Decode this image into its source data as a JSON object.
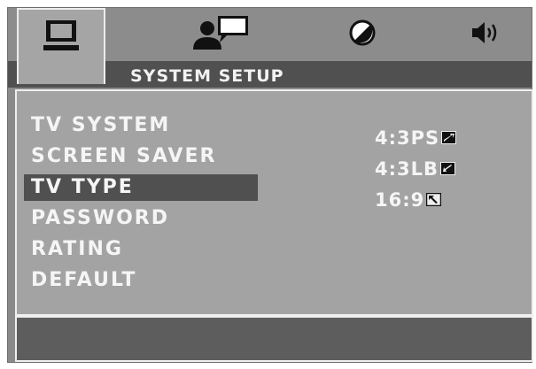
{
  "tabs": [
    {
      "icon": "monitor-icon",
      "active": true
    },
    {
      "icon": "person-chat-icon",
      "active": false
    },
    {
      "icon": "slashed-circle-icon",
      "active": false
    },
    {
      "icon": "speaker-icon",
      "active": false
    }
  ],
  "header": {
    "title": "SYSTEM SETUP"
  },
  "menu": {
    "items": [
      {
        "label": "TV SYSTEM",
        "selected": false
      },
      {
        "label": "SCREEN SAVER",
        "selected": false
      },
      {
        "label": "TV TYPE",
        "selected": true
      },
      {
        "label": "PASSWORD",
        "selected": false
      },
      {
        "label": "RATING",
        "selected": false
      },
      {
        "label": "DEFAULT",
        "selected": false
      }
    ]
  },
  "options": {
    "items": [
      {
        "label": "4:3PS",
        "icon": "aspect-ps-icon"
      },
      {
        "label": "4:3LB",
        "icon": "aspect-lb-icon"
      },
      {
        "label": "16:9",
        "icon": "aspect-wide-icon"
      }
    ]
  },
  "colors": {
    "panel": "#a3a3a3",
    "highlight": "#505050",
    "text": "#f5f5f5",
    "border": "#efefef"
  }
}
